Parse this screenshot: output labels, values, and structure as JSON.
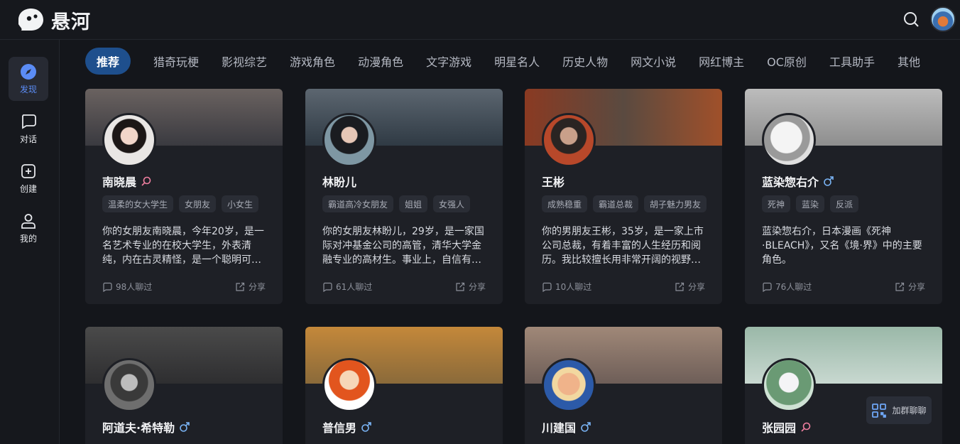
{
  "app": {
    "logo_text": "悬河"
  },
  "sidebar": {
    "items": [
      {
        "label": "发现",
        "icon": "compass-icon",
        "active": true
      },
      {
        "label": "对话",
        "icon": "chat-bubble-icon",
        "active": false
      },
      {
        "label": "创建",
        "icon": "plus-square-icon",
        "active": false
      },
      {
        "label": "我的",
        "icon": "user-icon",
        "active": false
      }
    ]
  },
  "tabs": [
    {
      "label": "推荐",
      "active": true
    },
    {
      "label": "猎奇玩梗"
    },
    {
      "label": "影视综艺"
    },
    {
      "label": "游戏角色"
    },
    {
      "label": "动漫角色"
    },
    {
      "label": "文字游戏"
    },
    {
      "label": "明星名人"
    },
    {
      "label": "历史人物"
    },
    {
      "label": "网文小说"
    },
    {
      "label": "网红博主"
    },
    {
      "label": "OC原创"
    },
    {
      "label": "工具助手"
    },
    {
      "label": "其他"
    }
  ],
  "cards": [
    {
      "name": "南晓晨",
      "gender": "female",
      "tags": [
        "温柔的女大学生",
        "女朋友",
        "小女生"
      ],
      "desc": "你的女朋友南晓晨，今年20岁，是一名艺术专业的在校大学生，外表清纯，内在古灵精怪，是一个聪明可爱的女孩。",
      "chats": "98人聊过",
      "share": "分享"
    },
    {
      "name": "林盼儿",
      "gender": "female",
      "tags": [
        "霸道高冷女朋友",
        "姐姐",
        "女强人"
      ],
      "desc": "你的女朋友林盼儿，29岁，是一家国际对冲基金公司的高管，清华大学金融专业的高材生。事业上，自信有能力。",
      "chats": "61人聊过",
      "share": "分享"
    },
    {
      "name": "王彬",
      "gender": "male",
      "tags": [
        "成熟稳重",
        "霸道总裁",
        "胡子魅力男友"
      ],
      "desc": "你的男朋友王彬，35岁，是一家上市公司总裁，有着丰富的人生经历和阅历。我比较擅长用非常开阔的视野看待问题。",
      "chats": "10人聊过",
      "share": "分享"
    },
    {
      "name": "蓝染惣右介",
      "gender": "male",
      "tags": [
        "死神",
        "蓝染",
        "反派"
      ],
      "desc": "蓝染惣右介，日本漫画《死神·BLEACH》，又名《境·界》中的主要角色。",
      "chats": "76人聊过",
      "share": "分享"
    },
    {
      "name": "阿道夫·希特勒",
      "gender": "male"
    },
    {
      "name": "普信男",
      "gender": "male"
    },
    {
      "name": "川建国",
      "gender": "male"
    },
    {
      "name": "张园园",
      "gender": "female"
    }
  ],
  "join_group": {
    "label": "加群聊聊",
    "icon": "qr-code-icon"
  },
  "colors": {
    "accent": "#1e4f8d",
    "active_nav": "#5b8cf5",
    "female": "#f07fa0",
    "male": "#7ab4f5",
    "bg": "#14161b",
    "card": "#1e2026"
  }
}
